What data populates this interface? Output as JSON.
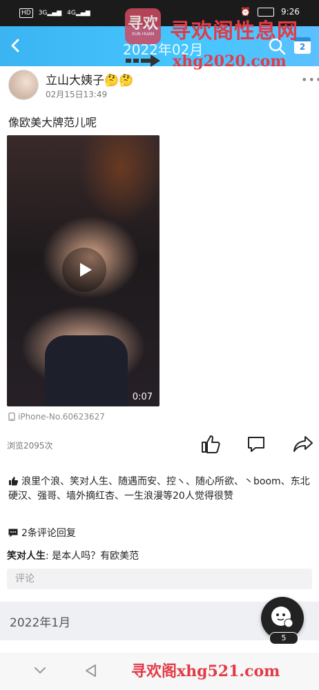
{
  "statusbar": {
    "left_badges": [
      "HD",
      "3G",
      "4G"
    ],
    "time": "9:26"
  },
  "header": {
    "title": "2022年02月",
    "back_icon": "chevron-left-icon",
    "search_icon": "search-icon",
    "calendar_icon": "calendar-icon",
    "calendar_day": "2"
  },
  "watermark": {
    "logo_big": "寻欢",
    "logo_small": "XUN HUAN",
    "site_name": "寻欢阁性息网",
    "domain_top": "xhg2020.com",
    "domain_bottom": "寻欢阁xhg521.com"
  },
  "post": {
    "author": "立山大姨子🤔🤔",
    "date": "02月15日13:49",
    "more": "•••",
    "text": "像欧美大牌范儿呢",
    "video": {
      "duration": "0:07"
    },
    "device": "iPhone-No.60623627",
    "views": "浏览2095次"
  },
  "likes": {
    "text": "浪里个浪、笑对人生、随遇而安、控ヽ、随心所欲、丶boom、东北硬汉、强哥、墙外摘红杏、一生浪漫等20人觉得很赞"
  },
  "comments": {
    "count_label": "2条评论回复",
    "items": [
      {
        "user": "笑对人生",
        "text": ": 是本人吗？有欧美范"
      }
    ],
    "input_placeholder": "评论"
  },
  "month_section": {
    "label": "2022年1月"
  },
  "floating": {
    "count": "5"
  },
  "colors": {
    "header": "#46c6ff",
    "watermark": "#e23b47"
  }
}
